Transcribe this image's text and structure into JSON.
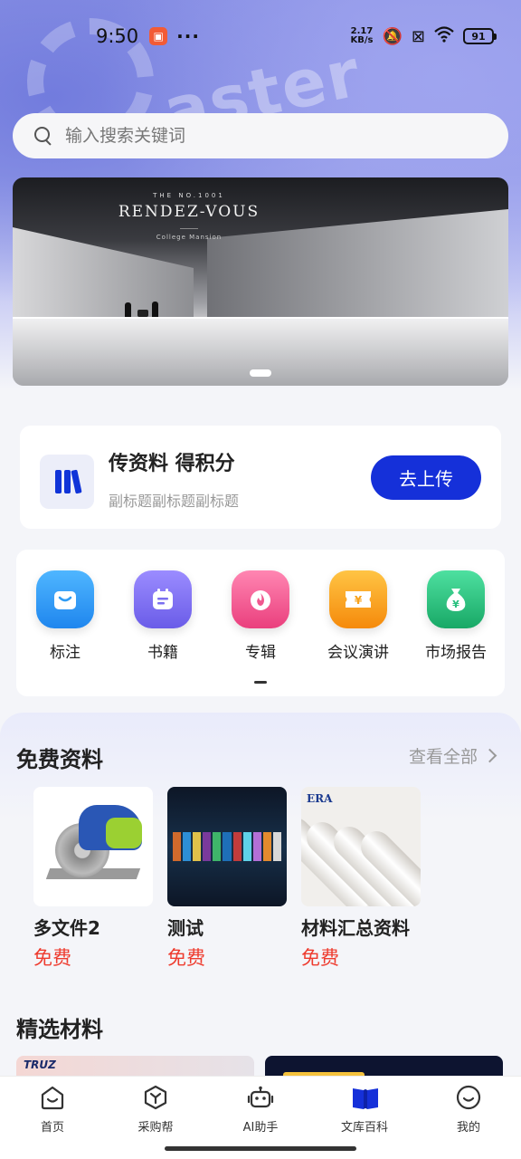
{
  "status_bar": {
    "time": "9:50",
    "dots": "···",
    "net_speed_value": "2.17",
    "net_speed_unit": "KB/s",
    "battery": "91"
  },
  "search": {
    "placeholder": "输入搜索关键词"
  },
  "banner": {
    "eyebrow": "THE NO.1001",
    "title": "RENDEZ-VOUS",
    "subtitle": "College Mansion"
  },
  "upload": {
    "title": "传资料 得积分",
    "subtitle": "副标题副标题副标题",
    "button": "去上传",
    "accent": "#1530d9"
  },
  "categories": [
    {
      "label": "标注",
      "icon": "bag-icon",
      "color": "#2f9cf5"
    },
    {
      "label": "书籍",
      "icon": "book-icon",
      "color": "#7a6ef0"
    },
    {
      "label": "专辑",
      "icon": "flame-icon",
      "color": "#f0588f"
    },
    {
      "label": "会议演讲",
      "icon": "ticket-icon",
      "color": "#f7a21b"
    },
    {
      "label": "市场报告",
      "icon": "money-bag-icon",
      "color": "#27c07e"
    }
  ],
  "free_section": {
    "title": "免费资料",
    "view_all": "查看全部",
    "items": [
      {
        "name": "多文件2",
        "price": "免费"
      },
      {
        "name": "测试",
        "price": "免费"
      },
      {
        "name": "材料汇总资料",
        "price": "免费"
      }
    ]
  },
  "selected_section": {
    "title": "精选材料"
  },
  "bottom_nav": [
    {
      "label": "首页",
      "icon": "home-icon"
    },
    {
      "label": "采购帮",
      "icon": "cube-icon"
    },
    {
      "label": "AI助手",
      "icon": "robot-icon"
    },
    {
      "label": "文库百科",
      "icon": "open-book-icon",
      "active": true
    },
    {
      "label": "我的",
      "icon": "smile-icon"
    }
  ]
}
